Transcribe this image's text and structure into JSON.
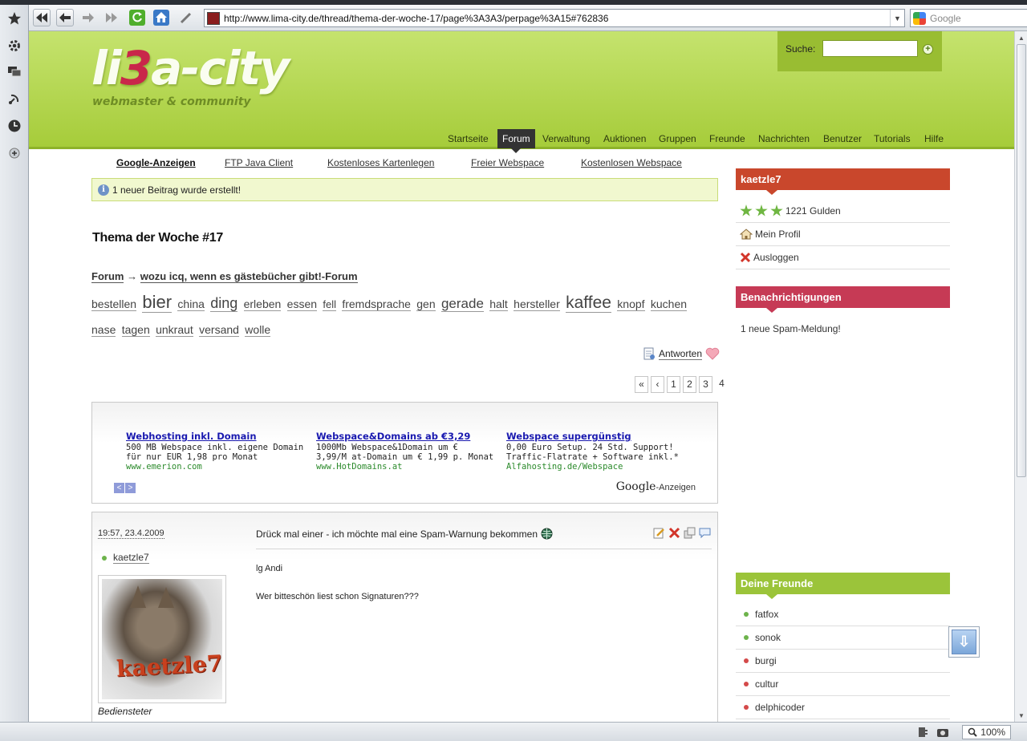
{
  "browser": {
    "url": "http://www.lima-city.de/thread/thema-der-woche-17/page%3A3A3/perpage%3A15#762836",
    "search_engine": "Google",
    "zoom": "100%"
  },
  "site": {
    "logo_text_a": "li",
    "logo_text_b": "3",
    "logo_text_c": "a-city",
    "tagline": "webmaster & community",
    "search_label": "Suche:",
    "search_value": "",
    "nav": [
      "Startseite",
      "Forum",
      "Verwaltung",
      "Auktionen",
      "Gruppen",
      "Freunde",
      "Nachrichten",
      "Benutzer",
      "Tutorials",
      "Hilfe"
    ],
    "nav_active": "Forum"
  },
  "ad_links": [
    "Google-Anzeigen",
    "FTP Java Client",
    "Kostenloses Kartenlegen",
    "Freier Webspace",
    "Kostenlosen Webspace"
  ],
  "notice": "1 neuer Beitrag wurde erstellt!",
  "thread": {
    "title": "Thema der Woche #17",
    "breadcrumb_root": "Forum",
    "breadcrumb_arrow": "→",
    "breadcrumb_forum": "wozu icq, wenn es gästebücher gibt!-Forum",
    "tags": [
      {
        "t": "bestellen",
        "s": 14
      },
      {
        "t": "bier",
        "s": 22
      },
      {
        "t": "china",
        "s": 14
      },
      {
        "t": "ding",
        "s": 18
      },
      {
        "t": "erleben",
        "s": 14
      },
      {
        "t": "essen",
        "s": 14
      },
      {
        "t": "fell",
        "s": 13
      },
      {
        "t": "fremdsprache",
        "s": 14
      },
      {
        "t": "gen",
        "s": 14
      },
      {
        "t": "gerade",
        "s": 17
      },
      {
        "t": "halt",
        "s": 14
      },
      {
        "t": "hersteller",
        "s": 14
      },
      {
        "t": "kaffee",
        "s": 21
      },
      {
        "t": "knopf",
        "s": 14
      },
      {
        "t": "kuchen",
        "s": 14
      },
      {
        "t": "nase",
        "s": 14
      },
      {
        "t": "tagen",
        "s": 14
      },
      {
        "t": "unkraut",
        "s": 14
      },
      {
        "t": "versand",
        "s": 14
      },
      {
        "t": "wolle",
        "s": 14
      }
    ],
    "reply_label": "Antworten",
    "pager": [
      "«",
      "‹",
      "1",
      "2",
      "3",
      "4"
    ],
    "current_page": "4"
  },
  "ads": [
    {
      "title": "Webhosting inkl. Domain",
      "line1": "500 MB Webspace inkl. eigene Domain",
      "line2": "für nur EUR 1,98 pro Monat",
      "url": "www.emerion.com"
    },
    {
      "title": "Webspace&Domains ab €3,29",
      "line1": "1000Mb Webspace&1Domain um €",
      "line2": "3,99/M at-Domain um € 1,99 p. Monat",
      "url": "www.HotDomains.at"
    },
    {
      "title": "Webspace supergünstig",
      "line1": "0,00 Euro Setup. 24 Std. Support!",
      "line2": "Traffic-Flatrate + Software inkl.*",
      "url": "Alfahosting.de/Webspace"
    }
  ],
  "ads_by_google": "Google",
  "ads_by_suffix": "-Anzeigen",
  "post": {
    "date": "19:57, 23.4.2009",
    "author": "kaetzle7",
    "avatar_text": "kaetzle7",
    "rank": "Bediensteter",
    "subject": "Drück mal einer - ich möchte mal eine Spam-Warnung bekommen",
    "body_line1": "lg Andi",
    "body_line2": "Wer bitteschön liest schon Signaturen???"
  },
  "user_box": {
    "name": "kaetzle7",
    "gulden": "1221 Gulden",
    "profile": "Mein Profil",
    "logout": "Ausloggen"
  },
  "notifications": {
    "title": "Benachrichtigungen",
    "text": "1 neue Spam-Meldung!"
  },
  "friends": {
    "title": "Deine Freunde",
    "list": [
      {
        "name": "fatfox",
        "online": true
      },
      {
        "name": "sonok",
        "online": true
      },
      {
        "name": "burgi",
        "online": false
      },
      {
        "name": "cultur",
        "online": false
      },
      {
        "name": "delphicoder",
        "online": false
      }
    ]
  },
  "colors": {
    "header_green": "#a6cc3a",
    "user_header": "#c9472c",
    "notif_header": "#c63a55",
    "friends_header": "#9bc43a"
  }
}
